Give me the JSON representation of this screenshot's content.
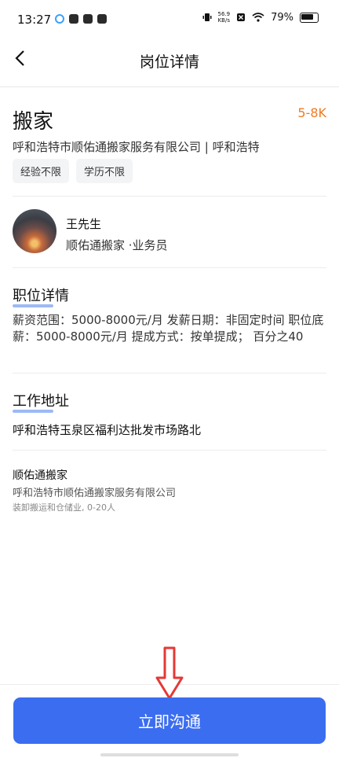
{
  "status_bar": {
    "time": "13:27",
    "app_icons": [
      "browser-icon",
      "player-icon",
      "sync-icon",
      "message-icon"
    ],
    "net_speed_value": "56.9",
    "net_speed_unit": "KB/s",
    "battery": "79%"
  },
  "nav": {
    "title": "岗位详情",
    "back_icon": "back-arrow-icon"
  },
  "job": {
    "title": "搬家",
    "salary": "5-8K",
    "company_line": "呼和浩特市顺佑通搬家服务有限公司 | 呼和浩特",
    "tags": [
      "经验不限",
      "学历不限"
    ]
  },
  "contact": {
    "name": "王先生",
    "role": "顺佑通搬家 ·业务员"
  },
  "details": {
    "title": "职位详情",
    "text": "薪资范围：5000-8000元/月 发薪日期：非固定时间 职位底薪：5000-8000元/月 提成方式：按单提成； 百分之40"
  },
  "work_address": {
    "title": "工作地址",
    "address": "呼和浩特玉泉区福利达批发市场路北"
  },
  "company": {
    "short_name": "顺佑通搬家",
    "full_name": "呼和浩特市顺佑通搬家服务有限公司",
    "info": "装卸搬运和仓储业, 0-20人"
  },
  "cta": {
    "label": "立即沟通"
  },
  "annotation": {
    "arrow_color": "#e53935"
  },
  "colors": {
    "accent": "#3b6df0",
    "salary": "#f07b22"
  }
}
